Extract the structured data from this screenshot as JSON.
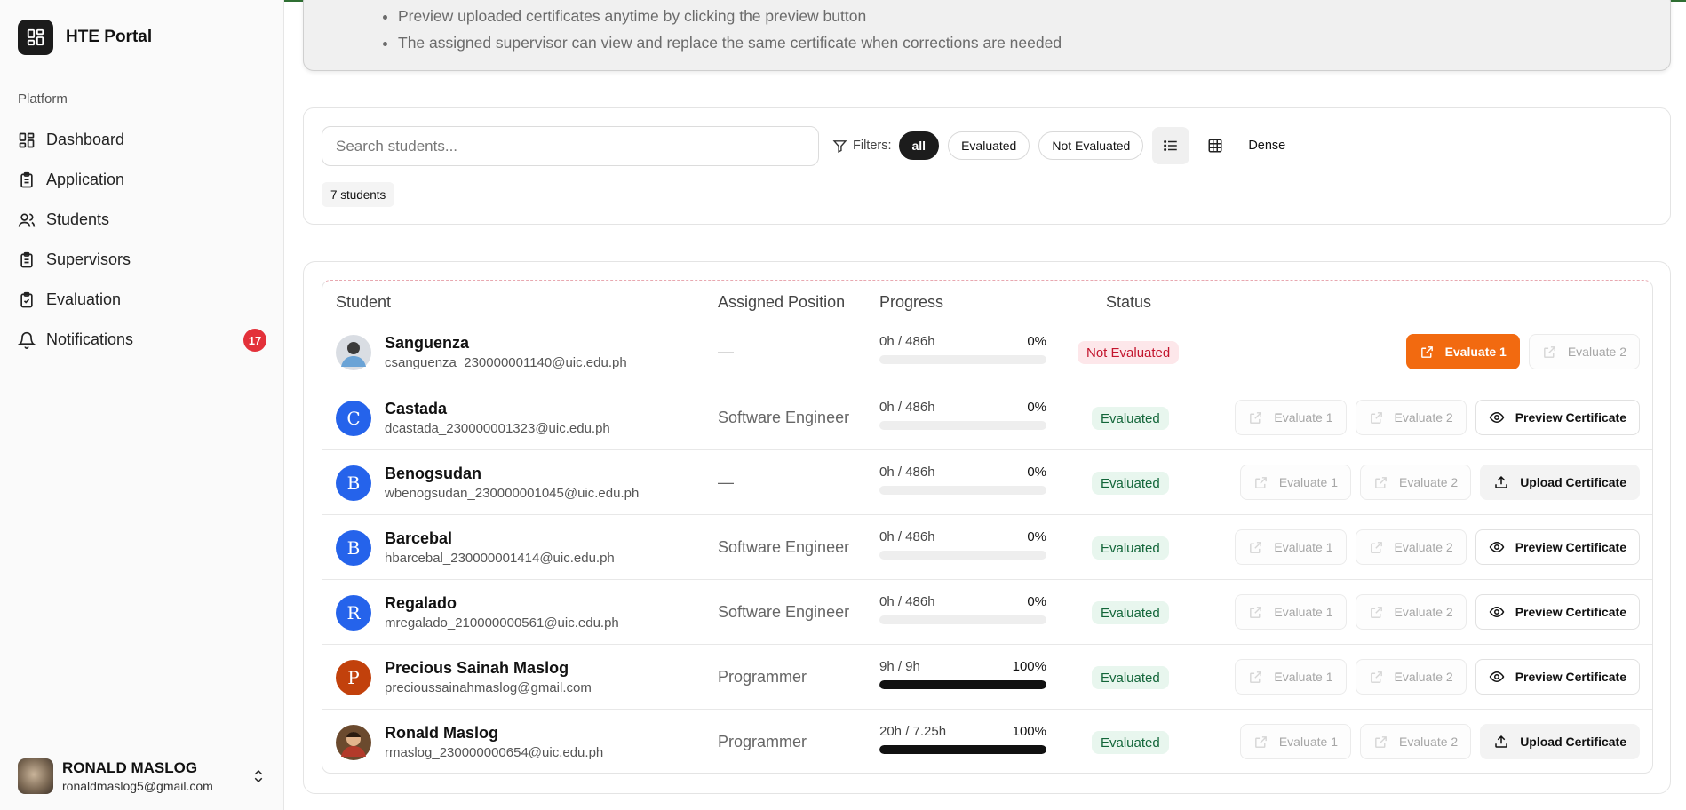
{
  "sidebar": {
    "app_name": "HTE Portal",
    "section_label": "Platform",
    "items": [
      {
        "label": "Dashboard"
      },
      {
        "label": "Application"
      },
      {
        "label": "Students"
      },
      {
        "label": "Supervisors"
      },
      {
        "label": "Evaluation"
      },
      {
        "label": "Notifications",
        "badge": "17"
      }
    ],
    "user": {
      "name": "RONALD MASLOG",
      "email": "ronaldmaslog5@gmail.com"
    }
  },
  "info": {
    "bullets": [
      "Preview uploaded certificates anytime by clicking the preview button",
      "The assigned supervisor can view and replace the same certificate when corrections are needed"
    ]
  },
  "filters": {
    "search_placeholder": "Search students...",
    "label": "Filters:",
    "chips": [
      "all",
      "Evaluated",
      "Not Evaluated"
    ],
    "active_chip": "all",
    "dense_label": "Dense",
    "count": "7 students"
  },
  "table": {
    "headers": {
      "student": "Student",
      "position": "Assigned Position",
      "progress": "Progress",
      "status": "Status"
    },
    "rows": [
      {
        "initial": "",
        "name": "Sanguenza",
        "email": "csanguenza_230000001140@uic.edu.ph",
        "position": "—",
        "hours": "0h / 486h",
        "pct": "0%",
        "fill": 0,
        "status": "Not Evaluated",
        "evaluated": false,
        "btn1": "Evaluate 1",
        "btn2": "Evaluate 2",
        "btn3": ""
      },
      {
        "initial": "C",
        "name": "Castada",
        "email": "dcastada_230000001323@uic.edu.ph",
        "position": "Software Engineer",
        "hours": "0h / 486h",
        "pct": "0%",
        "fill": 0,
        "status": "Evaluated",
        "evaluated": true,
        "btn1": "Evaluate 1",
        "btn2": "Evaluate 2",
        "btn3": "Preview Certificate"
      },
      {
        "initial": "B",
        "name": "Benogsudan",
        "email": "wbenogsudan_230000001045@uic.edu.ph",
        "position": "—",
        "hours": "0h / 486h",
        "pct": "0%",
        "fill": 0,
        "status": "Evaluated",
        "evaluated": true,
        "btn1": "Evaluate 1",
        "btn2": "Evaluate 2",
        "btn3": "Upload Certificate"
      },
      {
        "initial": "B",
        "name": "Barcebal",
        "email": "hbarcebal_230000001414@uic.edu.ph",
        "position": "Software Engineer",
        "hours": "0h / 486h",
        "pct": "0%",
        "fill": 0,
        "status": "Evaluated",
        "evaluated": true,
        "btn1": "Evaluate 1",
        "btn2": "Evaluate 2",
        "btn3": "Preview Certificate"
      },
      {
        "initial": "R",
        "name": "Regalado",
        "email": "mregalado_210000000561@uic.edu.ph",
        "position": "Software Engineer",
        "hours": "0h / 486h",
        "pct": "0%",
        "fill": 0,
        "status": "Evaluated",
        "evaluated": true,
        "btn1": "Evaluate 1",
        "btn2": "Evaluate 2",
        "btn3": "Preview Certificate"
      },
      {
        "initial": "P",
        "name": "Precious Sainah Maslog",
        "email": "precioussainahmaslog@gmail.com",
        "position": "Programmer",
        "hours": "9h / 9h",
        "pct": "100%",
        "fill": 1,
        "status": "Evaluated",
        "evaluated": true,
        "btn1": "Evaluate 1",
        "btn2": "Evaluate 2",
        "btn3": "Preview Certificate"
      },
      {
        "initial": "",
        "name": "Ronald Maslog",
        "email": "rmaslog_230000000654@uic.edu.ph",
        "position": "Programmer",
        "hours": "20h / 7.25h",
        "pct": "100%",
        "fill": 1,
        "status": "Evaluated",
        "evaluated": true,
        "btn1": "Evaluate 1",
        "btn2": "Evaluate 2",
        "btn3": "Upload Certificate"
      }
    ]
  },
  "colors": {
    "accent": "#f26a10",
    "avatar_blue": "#2563eb",
    "avatar_red": "#c2410c",
    "badge_red": "#e3313a"
  }
}
